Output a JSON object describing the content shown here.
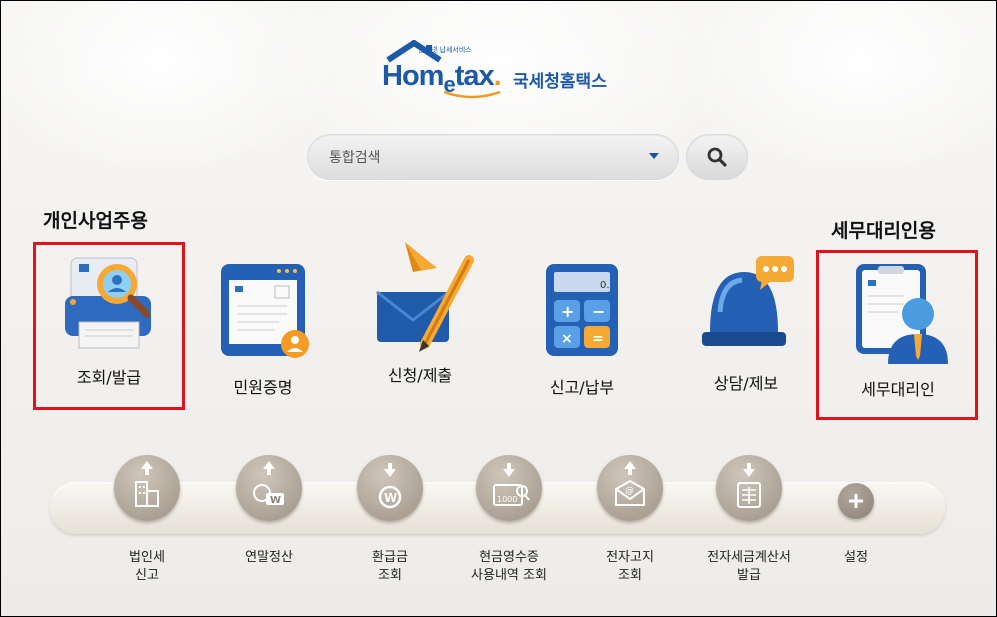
{
  "logo": {
    "small_text": "인터넷 납세서비스",
    "word_prefix": "Hom",
    "word_e": "e",
    "word_suffix": "tax",
    "dot": ".",
    "korean": "국세청홈택스"
  },
  "search": {
    "placeholder": "통합검색",
    "value": "통합검색"
  },
  "sections": {
    "individual": "개인사업주용",
    "agent": "세무대리인용"
  },
  "main_menu": [
    {
      "label": "조회/발급",
      "icon": "magnifier-document-icon"
    },
    {
      "label": "민원증명",
      "icon": "certificate-document-icon"
    },
    {
      "label": "신청/제출",
      "icon": "envelope-pencil-icon"
    },
    {
      "label": "신고/납부",
      "icon": "calculator-icon"
    },
    {
      "label": "상담/제보",
      "icon": "siren-chat-icon"
    },
    {
      "label": "세무대리인",
      "icon": "agent-person-icon"
    }
  ],
  "quick_menu": [
    {
      "line1": "법인세",
      "line2": "신고",
      "icon": "building-upload-icon"
    },
    {
      "line1": "연말정산",
      "line2": "",
      "icon": "won-person-upload-icon"
    },
    {
      "line1": "환급금",
      "line2": "조회",
      "icon": "won-refund-icon"
    },
    {
      "line1": "현금영수증",
      "line2": "사용내역 조회",
      "icon": "receipt-search-icon"
    },
    {
      "line1": "전자고지",
      "line2": "조회",
      "icon": "email-envelope-icon"
    },
    {
      "line1": "전자세금계산서",
      "line2": "발급",
      "icon": "invoice-download-icon"
    },
    {
      "line1": "설정",
      "line2": "",
      "icon": "plus-icon"
    }
  ],
  "colors": {
    "brand_blue": "#1d5aa6",
    "highlight_red": "#e0121c",
    "accent_orange": "#f39a1e"
  }
}
